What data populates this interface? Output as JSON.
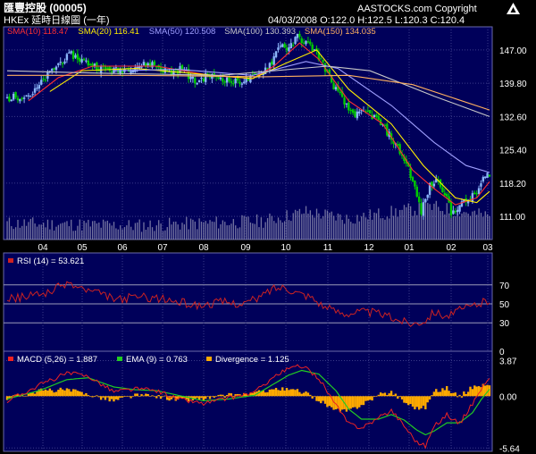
{
  "header": {
    "title": "匯豐控股 (00005)",
    "subtitle": "HKEx 延時日線圖 (一年)",
    "brand": "AASTOCKS.com Copyright",
    "ohlc": "04/03/2008  O:122.0  H:122.5  L:120.3  C:120.4"
  },
  "colors": {
    "background": "#000000",
    "panel": "#00005a",
    "grid": "#3b3b8a",
    "candle_up": "#8ab4f8",
    "candle_down": "#00cc00",
    "volume": "#9a9ab8",
    "sma10": "#ff3030",
    "sma20": "#ffee00",
    "sma50": "#a0a0ff",
    "sma100": "#c8c8c8",
    "sma150": "#ffb060",
    "rsi": "#cc2222",
    "macd": "#ee2222",
    "ema": "#22cc22",
    "divergence": "#ffaa00"
  },
  "chart_data": [
    {
      "type": "line",
      "title": "",
      "legend": [
        {
          "label": "SMA(10) 118.47",
          "color": "#ff3030"
        },
        {
          "label": "SMA(20) 116.41",
          "color": "#ffee00"
        },
        {
          "label": "SMA(50) 120.508",
          "color": "#a0a0ff"
        },
        {
          "label": "SMA(100) 130.393",
          "color": "#c8c8c8"
        },
        {
          "label": "SMA(150) 134.035",
          "color": "#ffb060"
        }
      ],
      "y_ticks": [
        "147.00",
        "139.80",
        "132.60",
        "125.40",
        "118.20",
        "111.00"
      ],
      "ylim": [
        106.0,
        152.0
      ],
      "x_ticks": [
        "04",
        "05",
        "06",
        "07",
        "08",
        "09",
        "10",
        "11",
        "12",
        "01",
        "02",
        "03"
      ],
      "close_keypoints": [
        [
          0,
          136.5
        ],
        [
          12,
          137.5
        ],
        [
          18,
          141.0
        ],
        [
          24,
          144.0
        ],
        [
          30,
          146.0
        ],
        [
          36,
          144.5
        ],
        [
          44,
          143.0
        ],
        [
          52,
          142.5
        ],
        [
          60,
          143.5
        ],
        [
          68,
          144.0
        ],
        [
          76,
          142.0
        ],
        [
          82,
          143.0
        ],
        [
          88,
          140.0
        ],
        [
          94,
          141.5
        ],
        [
          100,
          141.0
        ],
        [
          106,
          140.0
        ],
        [
          112,
          140.5
        ],
        [
          118,
          141.5
        ],
        [
          124,
          144.5
        ],
        [
          128,
          148.5
        ],
        [
          132,
          147.0
        ],
        [
          136,
          150.0
        ],
        [
          140,
          148.5
        ],
        [
          144,
          147.0
        ],
        [
          148,
          144.0
        ],
        [
          152,
          140.0
        ],
        [
          156,
          137.0
        ],
        [
          160,
          134.0
        ],
        [
          164,
          133.0
        ],
        [
          168,
          133.5
        ],
        [
          172,
          132.5
        ],
        [
          176,
          130.5
        ],
        [
          180,
          128.0
        ],
        [
          184,
          125.0
        ],
        [
          188,
          121.5
        ],
        [
          191,
          117.0
        ],
        [
          194,
          112.0
        ],
        [
          198,
          117.5
        ],
        [
          202,
          119.0
        ],
        [
          206,
          115.0
        ],
        [
          208,
          111.5
        ],
        [
          212,
          113.5
        ],
        [
          216,
          114.5
        ],
        [
          220,
          116.0
        ],
        [
          223,
          119.0
        ],
        [
          226,
          120.4
        ]
      ],
      "sma_keypoints": {
        "sma10": [
          [
            10,
            136.0
          ],
          [
            24,
            141.0
          ],
          [
            40,
            143.5
          ],
          [
            70,
            143.5
          ],
          [
            95,
            141.5
          ],
          [
            115,
            140.8
          ],
          [
            125,
            143.5
          ],
          [
            137,
            148.5
          ],
          [
            146,
            145.0
          ],
          [
            160,
            136.0
          ],
          [
            176,
            131.0
          ],
          [
            190,
            121.0
          ],
          [
            200,
            117.0
          ],
          [
            210,
            113.5
          ],
          [
            220,
            115.0
          ],
          [
            226,
            118.5
          ]
        ],
        "sma20": [
          [
            20,
            138.0
          ],
          [
            35,
            142.5
          ],
          [
            60,
            143.0
          ],
          [
            90,
            141.8
          ],
          [
            115,
            140.8
          ],
          [
            130,
            144.0
          ],
          [
            145,
            147.0
          ],
          [
            160,
            138.5
          ],
          [
            180,
            131.0
          ],
          [
            195,
            122.0
          ],
          [
            210,
            115.0
          ],
          [
            220,
            114.0
          ],
          [
            226,
            116.4
          ]
        ],
        "sma50": [
          [
            50,
            142.5
          ],
          [
            80,
            142.8
          ],
          [
            115,
            141.5
          ],
          [
            140,
            144.5
          ],
          [
            155,
            143.0
          ],
          [
            180,
            135.0
          ],
          [
            200,
            127.0
          ],
          [
            215,
            122.0
          ],
          [
            226,
            120.5
          ]
        ],
        "sma100": [
          [
            0,
            142.5
          ],
          [
            40,
            142.0
          ],
          [
            100,
            141.5
          ],
          [
            150,
            143.5
          ],
          [
            170,
            142.5
          ],
          [
            200,
            137.0
          ],
          [
            226,
            132.6
          ]
        ],
        "sma150": [
          [
            0,
            141.5
          ],
          [
            60,
            141.5
          ],
          [
            120,
            141.2
          ],
          [
            160,
            141.5
          ],
          [
            190,
            139.5
          ],
          [
            226,
            134.0
          ]
        ]
      },
      "volume_keypoints": [
        [
          0,
          4
        ],
        [
          60,
          3
        ],
        [
          120,
          5
        ],
        [
          140,
          9
        ],
        [
          160,
          6
        ],
        [
          190,
          10
        ],
        [
          200,
          11
        ],
        [
          226,
          7
        ]
      ]
    },
    {
      "type": "line",
      "legend": [
        {
          "label": "RSI (14) = 53.621",
          "color": "#cc2222"
        }
      ],
      "y_ticks": [
        "70",
        "50",
        "30",
        "0"
      ],
      "ylim": [
        0,
        100
      ],
      "keypoints": [
        [
          0,
          55
        ],
        [
          10,
          58
        ],
        [
          20,
          63
        ],
        [
          28,
          72
        ],
        [
          36,
          65
        ],
        [
          44,
          60
        ],
        [
          52,
          54
        ],
        [
          60,
          58
        ],
        [
          70,
          56
        ],
        [
          80,
          52
        ],
        [
          90,
          48
        ],
        [
          100,
          52
        ],
        [
          110,
          50
        ],
        [
          118,
          56
        ],
        [
          124,
          66
        ],
        [
          130,
          68
        ],
        [
          136,
          62
        ],
        [
          142,
          58
        ],
        [
          150,
          45
        ],
        [
          158,
          40
        ],
        [
          166,
          42
        ],
        [
          174,
          40
        ],
        [
          182,
          34
        ],
        [
          190,
          29
        ],
        [
          196,
          33
        ],
        [
          200,
          42
        ],
        [
          206,
          37
        ],
        [
          212,
          43
        ],
        [
          218,
          48
        ],
        [
          226,
          53.6
        ]
      ]
    },
    {
      "type": "bar",
      "legend": [
        {
          "label": "MACD (5,26) = 1.887",
          "color": "#ee2222"
        },
        {
          "label": "EMA (9) = 0.763",
          "color": "#22cc22"
        },
        {
          "label": "Divergence = 1.125",
          "color": "#ffaa00"
        }
      ],
      "y_ticks": [
        "3.87",
        "0.00",
        "-5.64"
      ],
      "ylim": [
        -6.0,
        4.5
      ],
      "macd_keypoints": [
        [
          0,
          -0.5
        ],
        [
          15,
          1.2
        ],
        [
          28,
          2.5
        ],
        [
          38,
          2.2
        ],
        [
          50,
          0.5
        ],
        [
          60,
          0.8
        ],
        [
          70,
          0.6
        ],
        [
          80,
          -0.3
        ],
        [
          92,
          -0.8
        ],
        [
          104,
          -0.2
        ],
        [
          116,
          0.4
        ],
        [
          124,
          2.0
        ],
        [
          132,
          3.0
        ],
        [
          138,
          3.3
        ],
        [
          146,
          2.0
        ],
        [
          154,
          -1.0
        ],
        [
          160,
          -3.0
        ],
        [
          166,
          -3.4
        ],
        [
          174,
          -2.4
        ],
        [
          180,
          -1.5
        ],
        [
          186,
          -3.2
        ],
        [
          192,
          -5.0
        ],
        [
          196,
          -5.4
        ],
        [
          200,
          -3.3
        ],
        [
          206,
          -2.0
        ],
        [
          212,
          -3.0
        ],
        [
          218,
          -0.8
        ],
        [
          222,
          0.8
        ],
        [
          226,
          1.9
        ]
      ],
      "ema_keypoints": [
        [
          0,
          -0.3
        ],
        [
          15,
          0.6
        ],
        [
          28,
          1.8
        ],
        [
          38,
          2.0
        ],
        [
          50,
          1.0
        ],
        [
          60,
          0.7
        ],
        [
          70,
          0.6
        ],
        [
          80,
          0.1
        ],
        [
          92,
          -0.5
        ],
        [
          104,
          -0.3
        ],
        [
          116,
          0.1
        ],
        [
          124,
          1.2
        ],
        [
          132,
          2.3
        ],
        [
          138,
          2.8
        ],
        [
          146,
          2.4
        ],
        [
          154,
          0.6
        ],
        [
          160,
          -1.4
        ],
        [
          166,
          -2.5
        ],
        [
          174,
          -2.5
        ],
        [
          180,
          -2.0
        ],
        [
          186,
          -2.6
        ],
        [
          192,
          -3.7
        ],
        [
          196,
          -4.2
        ],
        [
          200,
          -3.8
        ],
        [
          206,
          -2.9
        ],
        [
          212,
          -2.9
        ],
        [
          218,
          -1.8
        ],
        [
          222,
          -0.4
        ],
        [
          226,
          0.76
        ]
      ]
    }
  ]
}
